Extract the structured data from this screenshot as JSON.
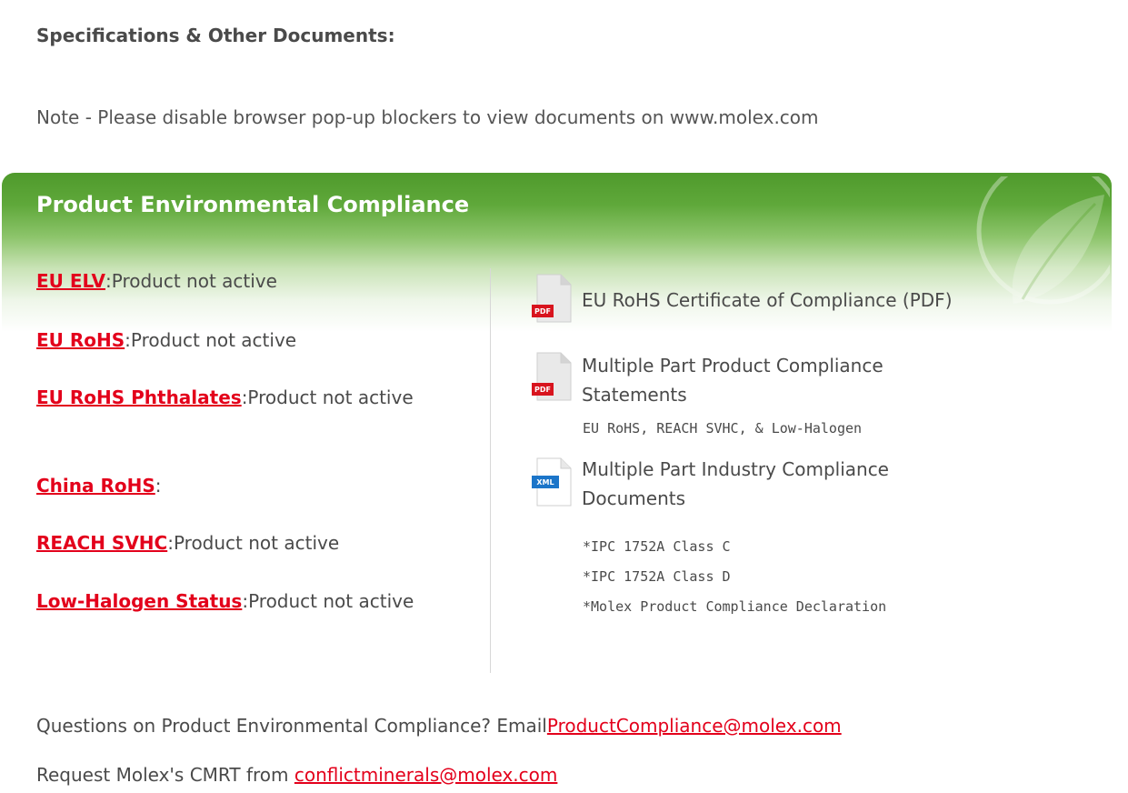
{
  "header": {
    "title": "Specifications & Other Documents:",
    "note": "Note - Please disable browser pop-up blockers to view documents on www.molex.com"
  },
  "compliance": {
    "title": "Product Environmental Compliance",
    "items": [
      {
        "label": "EU ELV",
        "status": ":Product not active"
      },
      {
        "label": "EU RoHS",
        "status": ":Product not active"
      },
      {
        "label": "EU RoHS Phthalates",
        "status": ":Product not active"
      },
      {
        "label": "China RoHS",
        "status": ":"
      },
      {
        "label": "REACH SVHC",
        "status": ":Product not active"
      },
      {
        "label": "Low-Halogen Status",
        "status": ":Product not active"
      }
    ],
    "documents": {
      "cert": {
        "label": "EU RoHS Certificate of Compliance (PDF)",
        "icon": "pdf-icon",
        "badge": "PDF"
      },
      "statements": {
        "label_line1": "Multiple Part Product Compliance",
        "label_line2": "Statements",
        "sub": "EU RoHS, REACH SVHC, & Low-Halogen",
        "icon": "pdf-icon",
        "badge": "PDF"
      },
      "industry": {
        "label_line1": "Multiple Part Industry Compliance",
        "label_line2": "Documents",
        "icon": "xml-icon",
        "badge": "XML",
        "sub_items": [
          "*IPC 1752A Class C",
          "*IPC 1752A Class D",
          "*Molex Product Compliance Declaration"
        ]
      }
    }
  },
  "footer": {
    "question_text": "Questions on Product Environmental Compliance? Email",
    "question_email": "ProductCompliance@molex.com",
    "cmrt_text": "Request Molex's CMRT from ",
    "cmrt_email": "conflictminerals@molex.com"
  },
  "colors": {
    "link": "#e3001b",
    "header_green": "#4f9a2c",
    "text": "#4a4a4a"
  }
}
